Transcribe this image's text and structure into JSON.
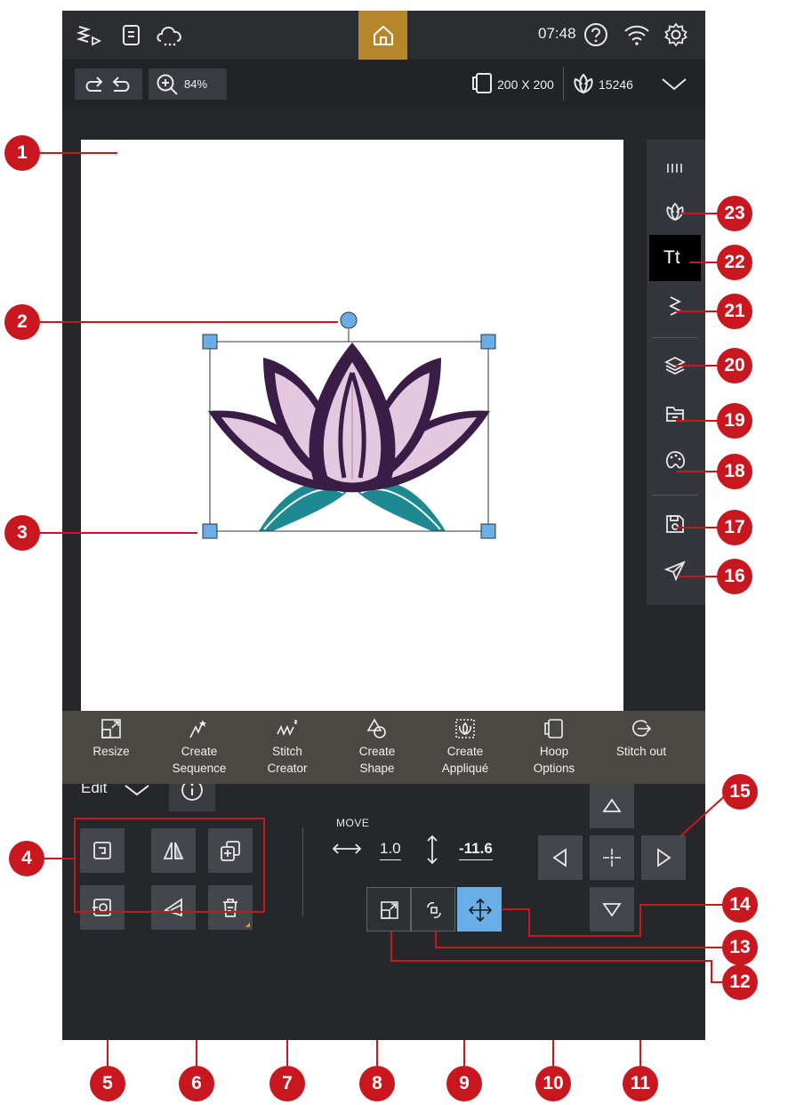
{
  "statusbar": {
    "time": "07:48",
    "icons": [
      "stitch-menu-icon",
      "book-icon",
      "cloud-icon",
      "home-icon",
      "help-icon",
      "wifi-icon",
      "settings-icon"
    ]
  },
  "toolbar": {
    "zoom": "84%",
    "hoop_size": "200 X 200",
    "stitch_count": "15246"
  },
  "sidebar": {
    "items": [
      "stitch-view-icon",
      "design-icon",
      "text-icon",
      "stitch-icon",
      "layers-icon",
      "folder-icon",
      "palette-icon",
      "save-icon",
      "send-icon"
    ],
    "text_label": "Tt"
  },
  "edit": {
    "mode_label": "Edit",
    "move_label": "MOVE",
    "horizontal": "1.0",
    "vertical": "-11.6"
  },
  "bottom_bar": {
    "items": [
      {
        "label": "Resize"
      },
      {
        "label": "Create\nSequence"
      },
      {
        "label": "Stitch\nCreator"
      },
      {
        "label": "Create\nShape"
      },
      {
        "label": "Create\nAppliqué"
      },
      {
        "label": "Hoop\nOptions"
      },
      {
        "label": "Stitch out"
      }
    ]
  },
  "callouts": [
    "1",
    "2",
    "3",
    "4",
    "5",
    "6",
    "7",
    "8",
    "9",
    "10",
    "11",
    "12",
    "13",
    "14",
    "15",
    "16",
    "17",
    "18",
    "19",
    "20",
    "21",
    "22",
    "23"
  ],
  "colors": {
    "accent": "#b6862a",
    "callout": "#c8171e",
    "handle": "#6aaee8",
    "lotus_dark": "#3a1d47",
    "lotus_pink": "#e5c8e0",
    "leaf_teal": "#1d8a92"
  }
}
